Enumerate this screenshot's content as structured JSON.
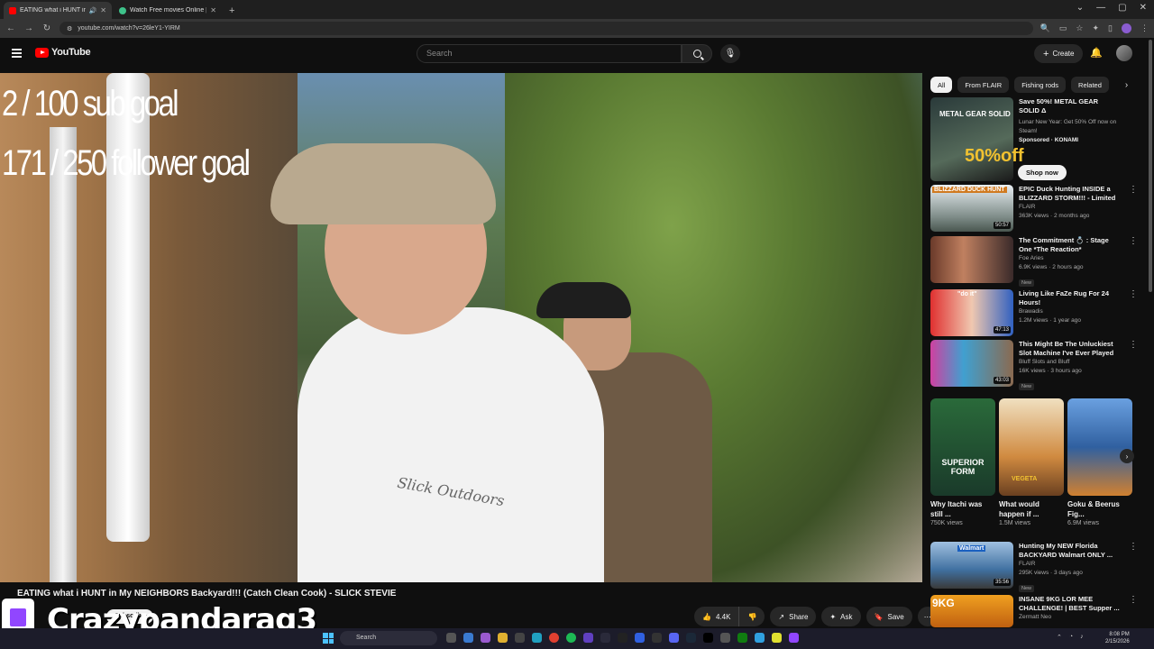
{
  "browser": {
    "tabs": [
      {
        "title": "EATING what i HUNT in My",
        "active": true
      },
      {
        "title": "Watch Free movies Online | 123",
        "active": false
      }
    ],
    "url": "youtube.com/watch?v=26leY1-YIRM"
  },
  "youtube": {
    "logo_text": "YouTube",
    "search_placeholder": "Search",
    "create_label": "Create"
  },
  "video": {
    "overlay_line1": "2 / 100 sub goal",
    "overlay_line2": "171 / 250 follower goal",
    "shirt_text": "Slick Outdoors",
    "title": "EATING what i HUNT in My NEIGHBORS Backyard!!! (Catch Clean Cook) - SLICK STEVIE",
    "streamer_name": "Crazypandarag3",
    "subscribe_label": "Subscribe",
    "like_count": "4.4K",
    "share_label": "Share",
    "ask_label": "Ask",
    "save_label": "Save"
  },
  "chips": [
    "All",
    "From FLAIR",
    "Fishing rods",
    "Related"
  ],
  "recommendations": [
    {
      "title": "Save 50%! METAL GEAR SOLID Δ",
      "line2": "Lunar New Year: Get 50% Off now on Steam!",
      "meta": "Sponsored · KONAMI",
      "thumb_text": "METAL GEAR SOLID",
      "thumb_sub": "50%off",
      "shop": "Shop now"
    },
    {
      "title": "EPIC Duck Hunting INSIDE a BLIZZARD STORM!!! - Limited ...",
      "channel": "FLAIR",
      "meta": "363K views · 2 months ago",
      "duration": "50:57",
      "thumb_text": "BLIZZARD DUCK HUNT"
    },
    {
      "title": "The Commitment 💍 : Stage One *The Reaction*",
      "channel": "Foe Aries",
      "meta": "6.9K views · 2 hours ago",
      "badge": "New"
    },
    {
      "title": "Living Like FaZe Rug For 24 Hours!",
      "channel": "Brawadis",
      "meta": "1.2M views · 1 year ago",
      "duration": "47:13",
      "thumb_text": "\"do it\""
    },
    {
      "title": "This Might Be The Unluckiest Slot Machine I've Ever Played",
      "channel": "Bluff Slots and Bluff",
      "meta": "16K views · 3 hours ago",
      "duration": "43:03",
      "badge": "New"
    }
  ],
  "shorts": [
    {
      "title": "Why Itachi was still ...",
      "views": "750K views",
      "thumb_text": "SUPERIOR FORM"
    },
    {
      "title": "What would happen if ...",
      "views": "1.5M views",
      "thumb_text": "VEGETA"
    },
    {
      "title": "Goku & Beerus Fig...",
      "views": "6.9M views"
    }
  ],
  "more_recommendations": [
    {
      "title": "Hunting My NEW Florida BACKYARD Walmart ONLY ...",
      "channel": "FLAIR",
      "meta": "295K views · 3 days ago",
      "duration": "35:56",
      "badge": "New",
      "thumb_text": "Walmart"
    },
    {
      "title": "INSANE 9KG LOR MEE CHALLENGE! | BEST Supper ...",
      "channel": "Zermatt Neo",
      "thumb_text": "9KG"
    }
  ],
  "taskbar": {
    "search_label": "Search",
    "time": "8:08 PM",
    "date": "2/15/2026"
  }
}
